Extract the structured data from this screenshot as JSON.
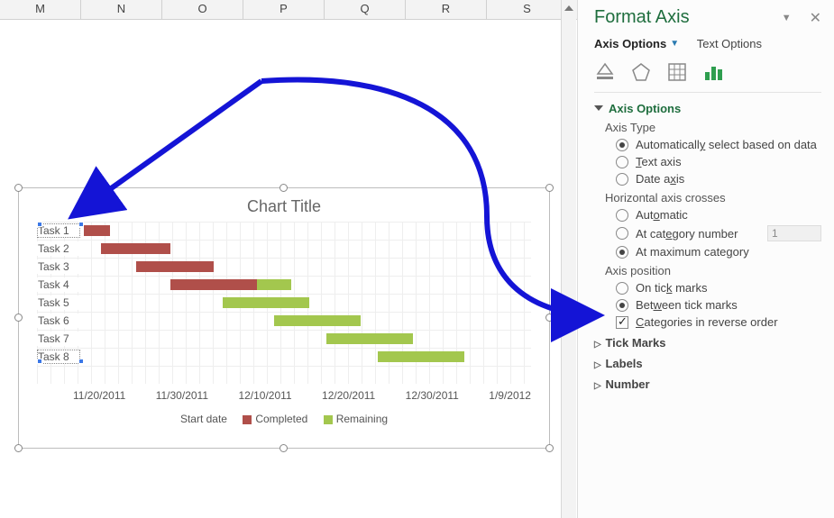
{
  "columns": [
    "M",
    "N",
    "O",
    "P",
    "Q",
    "R",
    "S"
  ],
  "chart": {
    "title": "Chart Title",
    "xlabels": [
      "11/20/2011",
      "11/30/2011",
      "12/10/2011",
      "12/20/2011",
      "12/30/2011",
      "1/9/2012"
    ],
    "tasks": [
      "Task 1",
      "Task 2",
      "Task 3",
      "Task 4",
      "Task 5",
      "Task 6",
      "Task 7",
      "Task 8"
    ],
    "legend": {
      "start": "Start date",
      "completed": "Completed",
      "remaining": "Remaining"
    }
  },
  "chart_data": {
    "type": "bar",
    "title": "Chart Title",
    "categories": [
      "Task 1",
      "Task 2",
      "Task 3",
      "Task 4",
      "Task 5",
      "Task 6",
      "Task 7",
      "Task 8"
    ],
    "series": [
      {
        "name": "Start date",
        "values": [
          "11/20/2011",
          "11/22/2011",
          "11/26/2011",
          "11/30/2011",
          "12/06/2011",
          "12/12/2011",
          "12/18/2011",
          "12/24/2011"
        ]
      },
      {
        "name": "Completed",
        "values": [
          3,
          8,
          9,
          10,
          0,
          0,
          0,
          0
        ]
      },
      {
        "name": "Remaining",
        "values": [
          0,
          0,
          0,
          4,
          10,
          10,
          10,
          10
        ]
      }
    ],
    "xlabel": "",
    "ylabel": "",
    "xticks": [
      "11/20/2011",
      "11/30/2011",
      "12/10/2011",
      "12/20/2011",
      "12/30/2011",
      "1/9/2012"
    ]
  },
  "sidebar": {
    "title": "Format Axis",
    "tab_axis": "Axis Options",
    "tab_text": "Text Options",
    "section_axis_options": "Axis Options",
    "axis_type_label": "Axis Type",
    "axis_type": {
      "auto": "Automatically select based on data",
      "text": "Text axis",
      "date": "Date axis"
    },
    "crosses_label": "Horizontal axis crosses",
    "crosses": {
      "auto": "Automatic",
      "at_cat": "At category number",
      "at_cat_value": "1",
      "at_max": "At maximum category"
    },
    "position_label": "Axis position",
    "position": {
      "on": "On tick marks",
      "between": "Between tick marks"
    },
    "reverse": "Categories in reverse order",
    "section_tick": "Tick Marks",
    "section_labels": "Labels",
    "section_number": "Number"
  }
}
